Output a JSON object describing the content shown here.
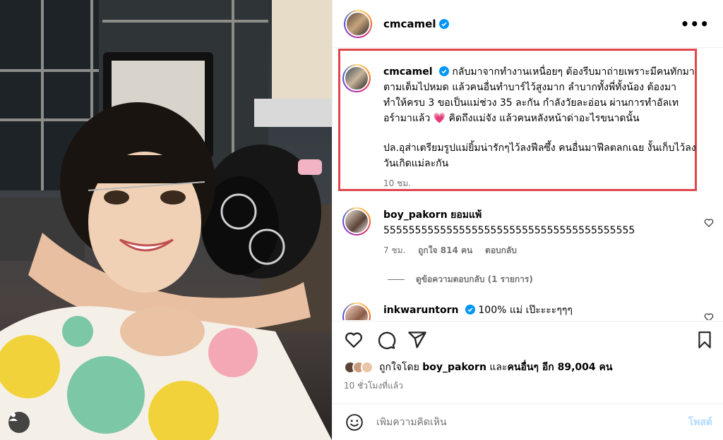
{
  "post": {
    "username": "cmcamel",
    "more_icon": "more-horizontal-icon"
  },
  "caption": {
    "username": "cmcamel",
    "text": "กลับมาจากทำงานเหนื่อยๆ ต้องรีบมาถ่ายเพราะมีคนทักมา\nตามเต็มไปหมด แล้วคนอื่นทำบาร์ไว้สูงมาก ลำบากทั้งพี่ทั้งน้อง ต้องมา\nทำให้ครบ 3 ขอเป็นแม่ช่วง 35 ละกัน กำลังวัยละอ่อน ผ่านการทำอัลเท\nอร์ามาแล้ว 💗 คิดถึงแม่จัง แล้วคนหลังหน้าด่าอะไรขนาดนั้น",
    "text2": "ปล.อุส่าเตรียมรูปแม่ยิ้มน่ารักๆไว้ลงฟีลซึ้ง คนอื่นมาฟีลตลกเฉย งั้นเก็บไว้ลง\nวันเกิดแม่ละกัน",
    "time": "10 ชม."
  },
  "comments": [
    {
      "username": "boy_pakorn",
      "lead": "ยอมแพ้",
      "text": "5555555555555555555555555555555555555555",
      "time": "7 ชม.",
      "likes": "ถูกใจ 814 คน",
      "reply": "ตอบกลับ",
      "view_replies": "ดูข้อความตอบกลับ (1 รายการ)"
    },
    {
      "username": "inkwaruntorn",
      "text": "100% แม่ เป๊ะะะะๆๆๆ"
    }
  ],
  "likes": {
    "prefix": "ถูกใจโดย",
    "user": "boy_pakorn",
    "middle": "และ",
    "others": "คนอื่นๆ อีก 89,004 คน"
  },
  "time_ago": "10 ชั่วโมงที่แล้ว",
  "add_comment": {
    "placeholder": "เพิ่มความคิดเห็น",
    "post_label": "โพสต์"
  },
  "colors": {
    "highlight_border": "#e0454c",
    "verified_blue": "#0095f6",
    "post_button_disabled": "#b3dbff",
    "secondary_text": "#737373"
  }
}
